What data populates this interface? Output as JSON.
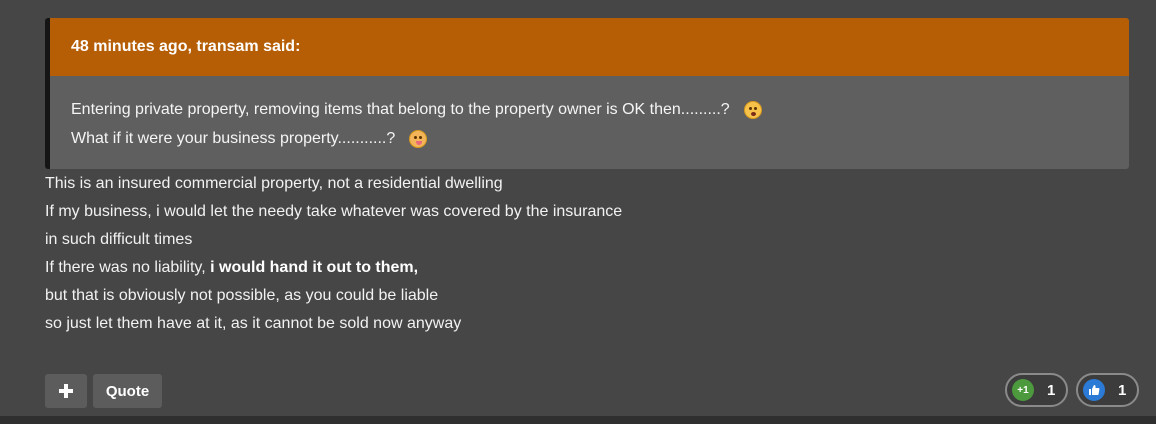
{
  "quote": {
    "header": "48 minutes ago, transam said:",
    "lines": [
      "Entering private property, removing items that belong to the property owner is OK then.........?",
      "What if it were your business property...........?"
    ],
    "emojis": [
      "shushing-face-icon",
      "smirking-face-icon"
    ]
  },
  "post": {
    "lines": [
      "This is an insured commercial property, not a residential dwelling",
      "If my business, i would let the needy take whatever was covered by the insurance",
      "in such difficult times"
    ],
    "line4_prefix": "If there was no liability, ",
    "line4_bold": "i would hand it out to them,",
    "line5": "but that is obviously not possible, as you could be liable",
    "line6": "so just let them have at it, as it cannot be sold now anyway"
  },
  "actions": {
    "quote_label": "Quote"
  },
  "reactions": [
    {
      "icon": "plus-one-icon",
      "badge": "+1",
      "count": "1",
      "color": "#4c9a3d"
    },
    {
      "icon": "thumbs-up-icon",
      "badge": "👍",
      "count": "1",
      "color": "#2b7bd6"
    }
  ],
  "colors": {
    "quote_header": "#b65e06",
    "quote_body": "#5f5f5f",
    "post_bg": "#464646"
  }
}
